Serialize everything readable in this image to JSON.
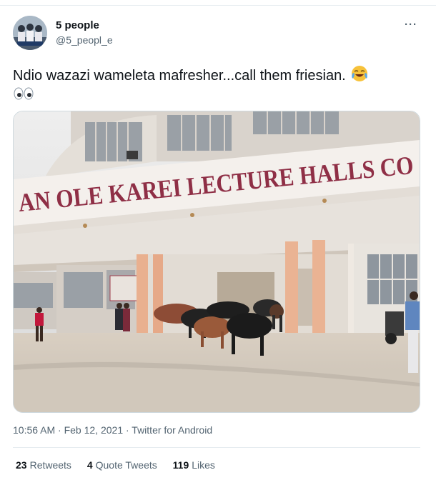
{
  "tweet": {
    "author_name": "5 people",
    "author_handle": "@5_peopl_e",
    "more_label": "···",
    "text": "Ndio wazazi wameleta mafresher...call them friesian.",
    "emoji_1": "face-with-tears-of-joy-icon",
    "emoji_2": "eyes-icon",
    "timestamp": "10:56 AM · Feb 12, 2021 · Twitter for Android"
  },
  "media": {
    "sign_text": "AN OLE KAREI LECTURE HALLS CO"
  },
  "stats": [
    {
      "count": "23",
      "label": "Retweets"
    },
    {
      "count": "4",
      "label": "Quote Tweets"
    },
    {
      "count": "119",
      "label": "Likes"
    }
  ],
  "colors": {
    "text": "#0f1419",
    "secondary": "#536471",
    "sign_text": "#8f2f46"
  }
}
